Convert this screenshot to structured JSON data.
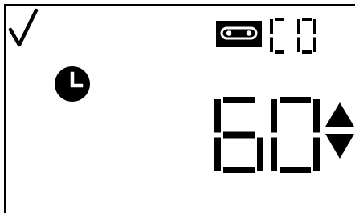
{
  "display": {
    "status": "ok",
    "mode_icon": "cassette-icon",
    "mode_code": "C0",
    "timer_icon": "clock-icon",
    "value": "60",
    "adjust_icon": "up-down-arrows-icon"
  },
  "colors": {
    "lcd_background": "#ffffff",
    "segment_on": "#000000"
  }
}
